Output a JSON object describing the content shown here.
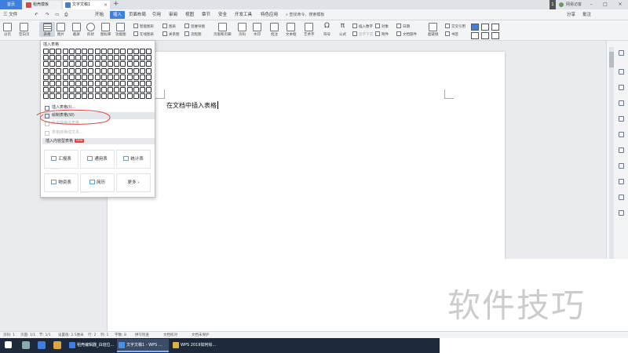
{
  "titlebar": {
    "tabs": [
      {
        "label": "首页"
      },
      {
        "label": "稻壳模板"
      },
      {
        "label": "文字文稿1"
      }
    ],
    "badge": "1",
    "user": "网易访客"
  },
  "menubar": {
    "file": "三 文件",
    "items": [
      "开始",
      "插入",
      "页面布局",
      "引用",
      "审阅",
      "视图",
      "章节",
      "安全",
      "开发工具",
      "特色应用"
    ],
    "active": "插入",
    "search": "查找命令、搜索模板",
    "share": "分享",
    "comment": "批注"
  },
  "ribbon": {
    "page_break": "分页",
    "blank_page": "空白页",
    "table": "表格",
    "image": "图片",
    "screenshot": "截屏",
    "shape": "形状",
    "icon_lib": "图标库",
    "function_chart": "功能图",
    "smart_shape": "智能图形",
    "online_chart": "在线图表",
    "chart": "图表",
    "relation_chart": "关系图",
    "mind_map": "思维导图",
    "flow_chart": "流程图",
    "header_footer": "页眉和页脚",
    "page_number": "页码",
    "watermark": "水印",
    "comment": "批注",
    "text_box": "文本框",
    "art_text": "艺术字",
    "symbol": "符号",
    "formula": "公式",
    "insert_number": "插入数字",
    "first_letter": "首字下沉",
    "object": "对象",
    "attachment": "附件",
    "date": "日期",
    "doc_parts": "文档部件",
    "hyperlink": "超链接",
    "cross_ref": "交叉引用",
    "bookmark": "书签"
  },
  "dropdown": {
    "header": "插入表格",
    "items": [
      {
        "label": "插入表格(I)...",
        "state": "normal"
      },
      {
        "label": "绘制表格(W)",
        "state": "hover"
      },
      {
        "label": "文本转换成表格",
        "state": "disabled"
      },
      {
        "label": "表格转换成文本...",
        "state": "disabled"
      }
    ],
    "section_title": "插入内容型表格",
    "section_badge": "NEW",
    "templates": [
      {
        "label": "汇报表"
      },
      {
        "label": "通用表"
      },
      {
        "label": "统计表"
      },
      {
        "label": "物资表"
      },
      {
        "label": "简历"
      },
      {
        "label": "更多 ›"
      }
    ]
  },
  "document": {
    "body_text": "在文档中插入表格"
  },
  "statusbar": {
    "page": "页码: 1",
    "pages": "页面: 1/1",
    "section": "节: 1/1",
    "position": "设置值: 2.5厘米",
    "row": "行: 2",
    "col": "列: 1",
    "words": "字数: 8",
    "spell": "拼写检查",
    "proof": "文档校对",
    "protect": "文档未保护"
  },
  "taskbar": {
    "apps": [
      {
        "label": "稻壳编辑器_白班位...",
        "active": false
      },
      {
        "label": "文字文稿1 - WPS ...",
        "active": true
      },
      {
        "label": "WPS 2019如何绘...",
        "active": false
      }
    ]
  },
  "watermark": "软件技巧",
  "colors": {
    "accent": "#3f7fe0",
    "annotation": "#e0463c"
  }
}
